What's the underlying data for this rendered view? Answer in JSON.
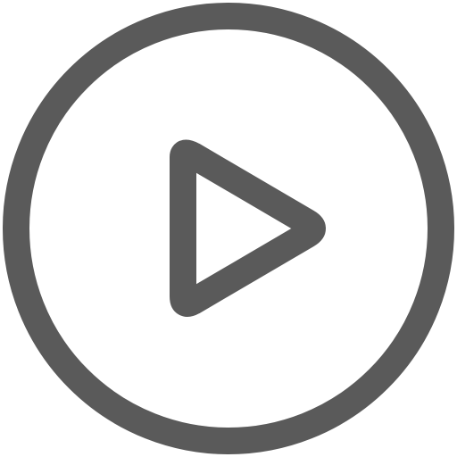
{
  "play_button": {
    "icon": "play-circle-outline-icon",
    "color": "#5a5a5a",
    "background": "#ffffff"
  }
}
